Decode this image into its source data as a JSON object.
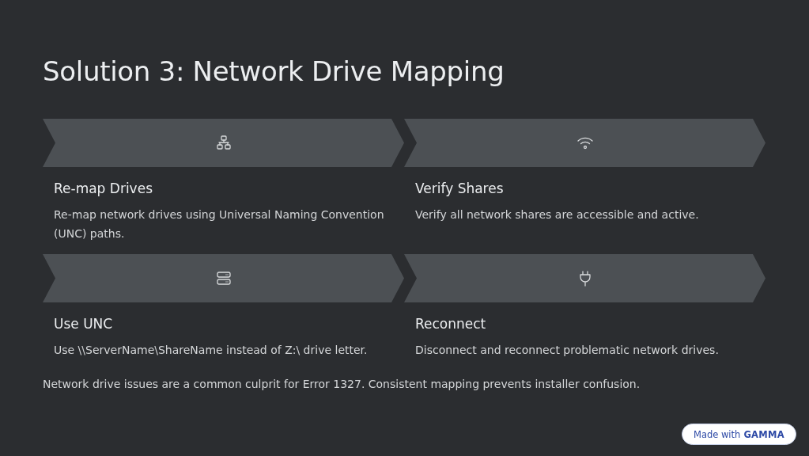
{
  "title": "Solution 3: Network Drive Mapping",
  "cards": [
    {
      "heading": "Re-map Drives",
      "text": "Re-map network drives using Universal Naming Convention (UNC) paths."
    },
    {
      "heading": "Verify Shares",
      "text": "Verify all network shares are accessible and active."
    },
    {
      "heading": "Use UNC",
      "text": "Use \\\\ServerName\\ShareName instead of Z:\\ drive letter."
    },
    {
      "heading": "Reconnect",
      "text": "Disconnect and reconnect problematic network drives."
    }
  ],
  "footer": "Network drive issues are a common culprit for Error 1327. Consistent mapping prevents installer confusion.",
  "badge": {
    "prefix": "Made with",
    "brand": "GAMMA"
  }
}
